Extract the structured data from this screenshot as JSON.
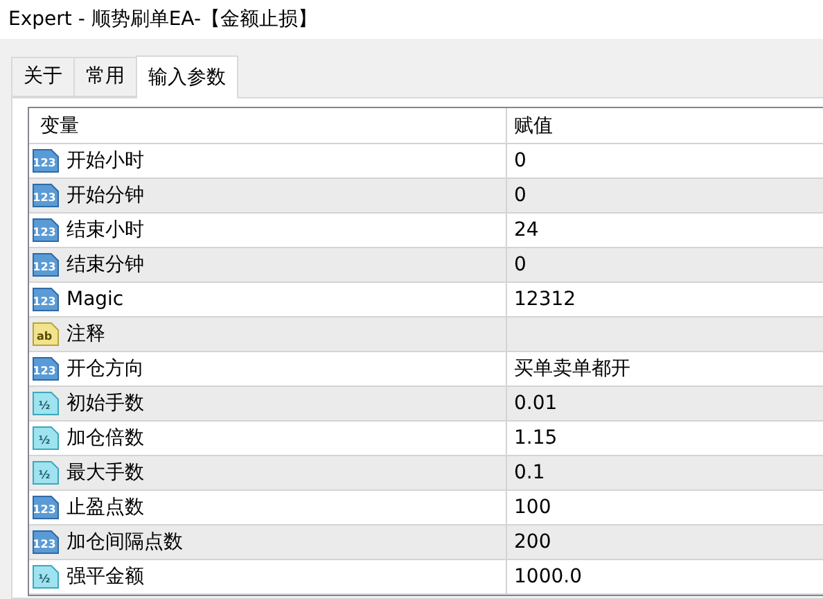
{
  "window": {
    "title": "Expert - 顺势刷单EA-【金额止损】"
  },
  "tabs": [
    {
      "label": "关于",
      "selected": false
    },
    {
      "label": "常用",
      "selected": false
    },
    {
      "label": "输入参数",
      "selected": true
    }
  ],
  "table": {
    "columns": [
      "变量",
      "赋值"
    ],
    "rows": [
      {
        "kind": "int",
        "type_label": "123",
        "name": "开始小时",
        "value": "0"
      },
      {
        "kind": "int",
        "type_label": "123",
        "name": "开始分钟",
        "value": "0"
      },
      {
        "kind": "int",
        "type_label": "123",
        "name": "结束小时",
        "value": "24"
      },
      {
        "kind": "int",
        "type_label": "123",
        "name": "结束分钟",
        "value": "0"
      },
      {
        "kind": "int",
        "type_label": "123",
        "name": "Magic",
        "value": "12312"
      },
      {
        "kind": "string",
        "type_label": "ab",
        "name": "注释"
      },
      {
        "kind": "int",
        "type_label": "123",
        "name": "开仓方向",
        "value": "买单卖单都开"
      },
      {
        "kind": "double",
        "type_label": "½",
        "name": "初始手数",
        "value": "0.01"
      },
      {
        "kind": "double",
        "type_label": "½",
        "name": "加仓倍数",
        "value": "1.15"
      },
      {
        "kind": "double",
        "type_label": "½",
        "name": "最大手数",
        "value": "0.1"
      },
      {
        "kind": "int",
        "type_label": "123",
        "name": "止盈点数",
        "value": "100"
      },
      {
        "kind": "int",
        "type_label": "123",
        "name": "加仓间隔点数",
        "value": "200"
      },
      {
        "kind": "double",
        "type_label": "½",
        "name": "强平金额",
        "value": "1000.0"
      }
    ]
  }
}
